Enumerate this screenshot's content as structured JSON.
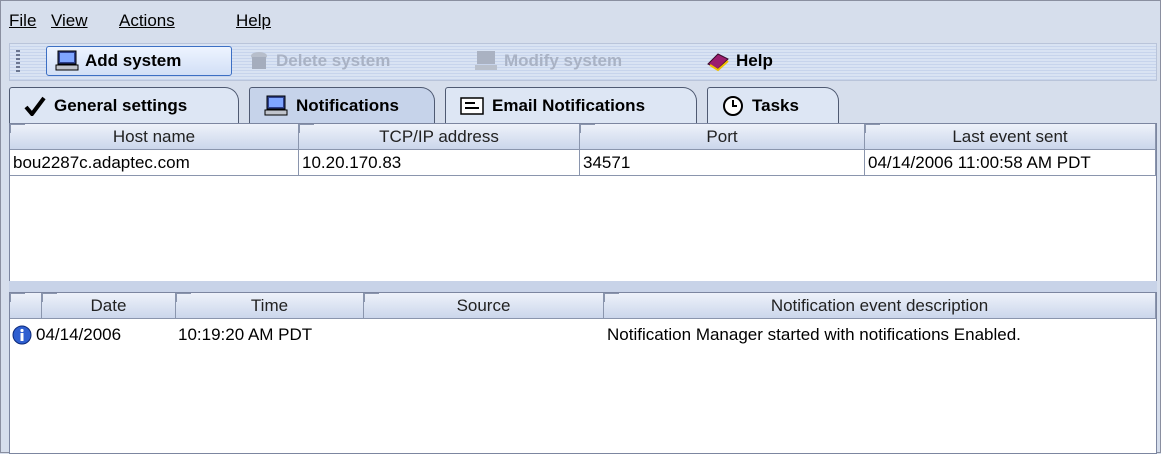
{
  "menu": {
    "items": [
      {
        "label": "File"
      },
      {
        "label": "View"
      },
      {
        "label": "Actions"
      },
      {
        "label": "Help"
      }
    ]
  },
  "toolbar": {
    "add_system": "Add system",
    "delete_system": "Delete system",
    "modify_system": "Modify system",
    "help": "Help"
  },
  "tabs": {
    "general": "General settings",
    "notifications": "Notifications",
    "email": "Email Notifications",
    "tasks": "Tasks",
    "active": "Notifications"
  },
  "systems_table": {
    "columns": [
      "Host name",
      "TCP/IP address",
      "Port",
      "Last event sent"
    ],
    "rows": [
      [
        "bou2287c.adaptec.com",
        "10.20.170.83",
        "34571",
        "04/14/2006 11:00:58 AM PDT"
      ]
    ]
  },
  "events_table": {
    "columns": [
      "Date",
      "Time",
      "Source",
      "Notification event description"
    ],
    "rows": [
      {
        "icon": "info-icon",
        "date": "04/14/2006",
        "time": "10:19:20 AM PDT",
        "source": "",
        "description": "Notification Manager started with notifications Enabled."
      }
    ]
  },
  "colors": {
    "background": "#d6deec",
    "active_button_border": "#3c6fc4",
    "disabled_text": "#a9b2c4"
  }
}
